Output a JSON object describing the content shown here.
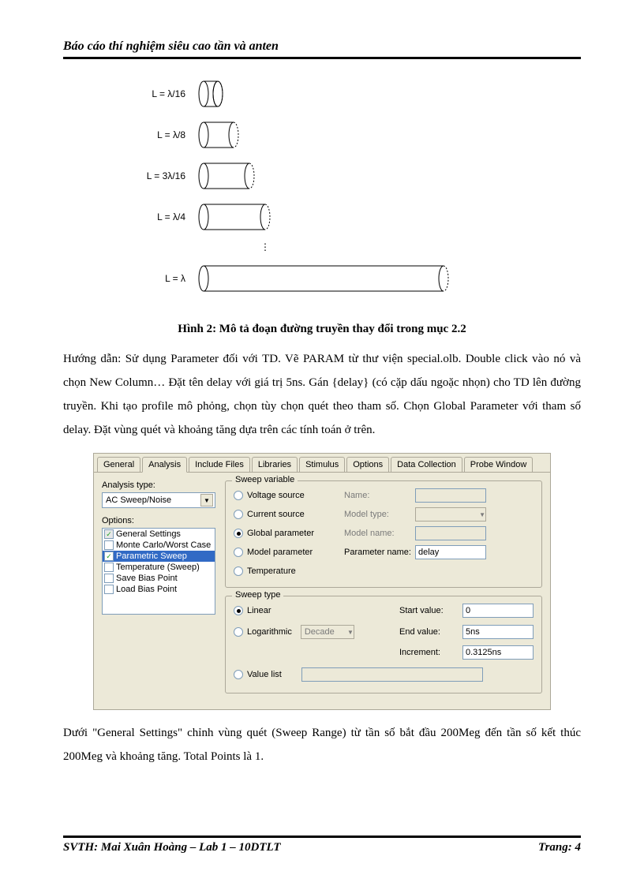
{
  "header": {
    "title": "Báo cáo thí nghiệm siêu cao tần và anten"
  },
  "diagram": {
    "labels": [
      "L = λ/16",
      "L = λ/8",
      "L = 3λ/16",
      "L = λ/4",
      "L = λ"
    ]
  },
  "figure_caption": "Hình 2: Mô tả đoạn đường truyền thay đổi trong mục 2.2",
  "paragraph1": "Hướng dẫn: Sử dụng Parameter đối với TD. Vẽ PARAM từ thư viện special.olb. Double click vào nó và chọn New Column… Đặt tên delay với giá trị 5ns. Gán {delay} (có cặp dấu ngoặc nhọn) cho TD lên đường truyền. Khi tạo profile mô phỏng, chọn tùy chọn quét theo tham số. Chọn Global Parameter với tham số delay. Đặt vùng quét và khoảng tăng dựa trên các tính toán ở trên.",
  "paragraph2": "Dưới \"General Settings\" chỉnh vùng quét (Sweep Range) từ tần số bắt đầu 200Meg đến tần số kết thúc 200Meg và khoảng tăng. Total Points là 1.",
  "dialog": {
    "tabs": [
      "General",
      "Analysis",
      "Include Files",
      "Libraries",
      "Stimulus",
      "Options",
      "Data Collection",
      "Probe Window"
    ],
    "active_tab": "Analysis",
    "analysis_type_label": "Analysis type:",
    "analysis_type_value": "AC Sweep/Noise",
    "options_label": "Options:",
    "options_list": [
      {
        "label": "General Settings",
        "checked": true,
        "disabled": true
      },
      {
        "label": "Monte Carlo/Worst Case",
        "checked": false
      },
      {
        "label": "Parametric Sweep",
        "checked": true,
        "selected": true
      },
      {
        "label": "Temperature (Sweep)",
        "checked": false
      },
      {
        "label": "Save Bias Point",
        "checked": false
      },
      {
        "label": "Load Bias Point",
        "checked": false
      }
    ],
    "sweep_variable": {
      "legend": "Sweep variable",
      "radios": [
        "Voltage source",
        "Current source",
        "Global parameter",
        "Model parameter",
        "Temperature"
      ],
      "selected": "Global parameter",
      "name_label": "Name:",
      "model_type_label": "Model type:",
      "model_name_label": "Model name:",
      "param_name_label": "Parameter name:",
      "param_name_value": "delay"
    },
    "sweep_type": {
      "legend": "Sweep type",
      "linear": "Linear",
      "logarithmic": "Logarithmic",
      "log_scale": "Decade",
      "selected": "Linear",
      "start_label": "Start value:",
      "start_value": "0",
      "end_label": "End value:",
      "end_value": "5ns",
      "inc_label": "Increment:",
      "inc_value": "0.3125ns",
      "value_list": "Value list"
    }
  },
  "footer": {
    "left": "SVTH: Mai Xuân Hoàng – Lab 1 – 10DTLT",
    "right": "Trang: 4"
  }
}
